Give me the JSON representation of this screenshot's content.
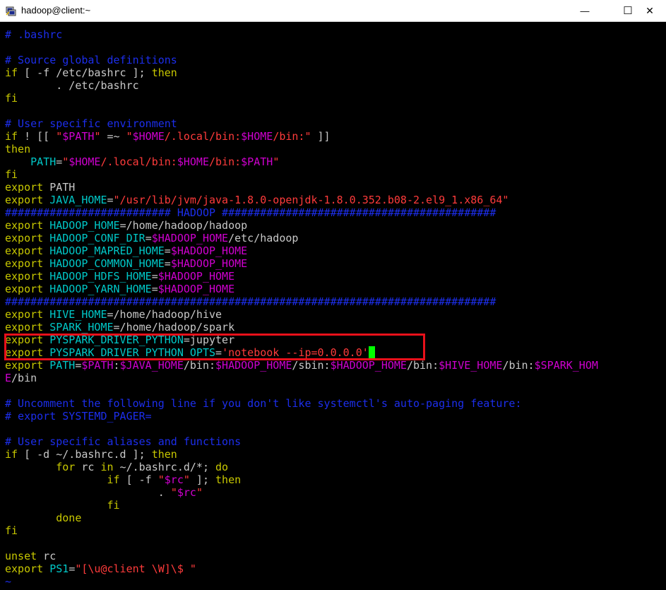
{
  "window": {
    "title": "hadoop@client:~",
    "minimize_glyph": "—",
    "maximize_glyph": "☐",
    "close_glyph": "✕"
  },
  "icons": {
    "app": "putty-terminal-icon"
  },
  "colors": {
    "comment": "#1c2eec",
    "keyword": "#c8c800",
    "identifier": "#00c8c8",
    "string": "#ff3b3b",
    "variable": "#d000d0",
    "text": "#c8c8c8",
    "cursor": "#00ff00",
    "highlight": "#e8101a"
  },
  "editor": {
    "lines": [
      [
        [
          "comment",
          "# .bashrc"
        ]
      ],
      [],
      [
        [
          "comment",
          "# Source global definitions"
        ]
      ],
      [
        [
          "kw",
          "if"
        ],
        [
          "text",
          " [ -f /etc/bashrc ]; "
        ],
        [
          "kw",
          "then"
        ]
      ],
      [
        [
          "text",
          "        . /etc/bashrc"
        ]
      ],
      [
        [
          "kw",
          "fi"
        ]
      ],
      [],
      [
        [
          "comment",
          "# User specific environment"
        ]
      ],
      [
        [
          "kw",
          "if"
        ],
        [
          "text",
          " ! [[ "
        ],
        [
          "str",
          "\""
        ],
        [
          "env",
          "$PATH"
        ],
        [
          "str",
          "\""
        ],
        [
          "text",
          " =~ "
        ],
        [
          "str",
          "\""
        ],
        [
          "env",
          "$HOME"
        ],
        [
          "str",
          "/.local/bin:"
        ],
        [
          "env",
          "$HOME"
        ],
        [
          "str",
          "/bin:\""
        ],
        [
          "text",
          " ]]"
        ]
      ],
      [
        [
          "kw",
          "then"
        ]
      ],
      [
        [
          "text",
          "    "
        ],
        [
          "var",
          "PATH"
        ],
        [
          "text",
          "="
        ],
        [
          "str",
          "\""
        ],
        [
          "env",
          "$HOME"
        ],
        [
          "str",
          "/.local/bin:"
        ],
        [
          "env",
          "$HOME"
        ],
        [
          "str",
          "/bin:"
        ],
        [
          "env",
          "$PATH"
        ],
        [
          "str",
          "\""
        ]
      ],
      [
        [
          "kw",
          "fi"
        ]
      ],
      [
        [
          "kw",
          "export"
        ],
        [
          "text",
          " PATH"
        ]
      ],
      [
        [
          "kw",
          "export"
        ],
        [
          "text",
          " "
        ],
        [
          "var",
          "JAVA_HOME"
        ],
        [
          "text",
          "="
        ],
        [
          "str",
          "\"/usr/lib/jvm/java-1.8.0-openjdk-1.8.0.352.b08-2.el9_1.x86_64\""
        ]
      ],
      [
        [
          "comment",
          "########################## HADOOP ###########################################"
        ]
      ],
      [
        [
          "kw",
          "export"
        ],
        [
          "text",
          " "
        ],
        [
          "var",
          "HADOOP_HOME"
        ],
        [
          "text",
          "=/home/hadoop/hadoop"
        ]
      ],
      [
        [
          "kw",
          "export"
        ],
        [
          "text",
          " "
        ],
        [
          "var",
          "HADOOP_CONF_DIR"
        ],
        [
          "text",
          "="
        ],
        [
          "env",
          "$HADOOP_HOME"
        ],
        [
          "text",
          "/etc/hadoop"
        ]
      ],
      [
        [
          "kw",
          "export"
        ],
        [
          "text",
          " "
        ],
        [
          "var",
          "HADOOP_MAPRED_HOME"
        ],
        [
          "text",
          "="
        ],
        [
          "env",
          "$HADOOP_HOME"
        ]
      ],
      [
        [
          "kw",
          "export"
        ],
        [
          "text",
          " "
        ],
        [
          "var",
          "HADOOP_COMMON_HOME"
        ],
        [
          "text",
          "="
        ],
        [
          "env",
          "$HADOOP_HOME"
        ]
      ],
      [
        [
          "kw",
          "export"
        ],
        [
          "text",
          " "
        ],
        [
          "var",
          "HADOOP_HDFS_HOME"
        ],
        [
          "text",
          "="
        ],
        [
          "env",
          "$HADOOP_HOME"
        ]
      ],
      [
        [
          "kw",
          "export"
        ],
        [
          "text",
          " "
        ],
        [
          "var",
          "HADOOP_YARN_HOME"
        ],
        [
          "text",
          "="
        ],
        [
          "env",
          "$HADOOP_HOME"
        ]
      ],
      [
        [
          "comment",
          "#############################################################################"
        ]
      ],
      [
        [
          "kw",
          "export"
        ],
        [
          "text",
          " "
        ],
        [
          "var",
          "HIVE_HOME"
        ],
        [
          "text",
          "=/home/hadoop/hive"
        ]
      ],
      [
        [
          "kw",
          "export"
        ],
        [
          "text",
          " "
        ],
        [
          "var",
          "SPARK_HOME"
        ],
        [
          "text",
          "=/home/hadoop/spark"
        ]
      ],
      [
        [
          "kw",
          "export"
        ],
        [
          "text",
          " "
        ],
        [
          "var",
          "PYSPARK_DRIVER_PYTHON"
        ],
        [
          "text",
          "=jupyter"
        ]
      ],
      [
        [
          "kw",
          "export"
        ],
        [
          "text",
          " "
        ],
        [
          "var",
          "PYSPARK_DRIVER_PYTHON_OPTS"
        ],
        [
          "text",
          "="
        ],
        [
          "str",
          "'notebook --ip=0.0.0.0'"
        ],
        [
          "cursor",
          ""
        ]
      ],
      [
        [
          "kw",
          "export"
        ],
        [
          "text",
          " "
        ],
        [
          "var",
          "PATH"
        ],
        [
          "text",
          "="
        ],
        [
          "env",
          "$PATH"
        ],
        [
          "text",
          ":"
        ],
        [
          "env",
          "$JAVA_HOME"
        ],
        [
          "text",
          "/bin:"
        ],
        [
          "env",
          "$HADOOP_HOME"
        ],
        [
          "text",
          "/sbin:"
        ],
        [
          "env",
          "$HADOOP_HOME"
        ],
        [
          "text",
          "/bin:"
        ],
        [
          "env",
          "$HIVE_HOME"
        ],
        [
          "text",
          "/bin:"
        ],
        [
          "env",
          "$SPARK_HOM"
        ]
      ],
      [
        [
          "env",
          "E"
        ],
        [
          "text",
          "/bin"
        ]
      ],
      [],
      [
        [
          "comment",
          "# Uncomment the following line if you don't like systemctl's auto-paging feature:"
        ]
      ],
      [
        [
          "comment",
          "# export SYSTEMD_PAGER="
        ]
      ],
      [],
      [
        [
          "comment",
          "# User specific aliases and functions"
        ]
      ],
      [
        [
          "kw",
          "if"
        ],
        [
          "text",
          " [ -d ~/.bashrc.d ]; "
        ],
        [
          "kw",
          "then"
        ]
      ],
      [
        [
          "text",
          "        "
        ],
        [
          "kw",
          "for"
        ],
        [
          "text",
          " rc "
        ],
        [
          "kw",
          "in"
        ],
        [
          "text",
          " ~/.bashrc.d/*; "
        ],
        [
          "kw",
          "do"
        ]
      ],
      [
        [
          "text",
          "                "
        ],
        [
          "kw",
          "if"
        ],
        [
          "text",
          " [ -f "
        ],
        [
          "str",
          "\""
        ],
        [
          "env",
          "$rc"
        ],
        [
          "str",
          "\""
        ],
        [
          "text",
          " ]; "
        ],
        [
          "kw",
          "then"
        ]
      ],
      [
        [
          "text",
          "                        . "
        ],
        [
          "str",
          "\""
        ],
        [
          "env",
          "$rc"
        ],
        [
          "str",
          "\""
        ]
      ],
      [
        [
          "text",
          "                "
        ],
        [
          "kw",
          "fi"
        ]
      ],
      [
        [
          "text",
          "        "
        ],
        [
          "kw",
          "done"
        ]
      ],
      [
        [
          "kw",
          "fi"
        ]
      ],
      [],
      [
        [
          "kw",
          "unset"
        ],
        [
          "text",
          " rc"
        ]
      ],
      [
        [
          "kw",
          "export"
        ],
        [
          "text",
          " "
        ],
        [
          "var",
          "PS1"
        ],
        [
          "text",
          "="
        ],
        [
          "str",
          "\"[\\u@client \\W]\\$ \""
        ]
      ],
      [
        [
          "tilde",
          "~"
        ]
      ]
    ]
  }
}
